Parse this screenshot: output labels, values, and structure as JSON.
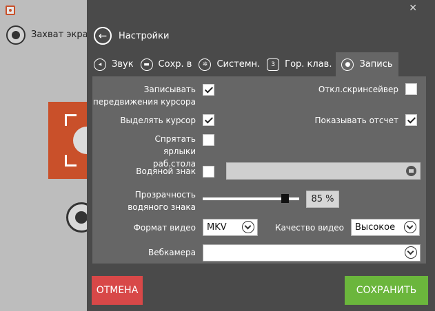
{
  "background_app": {
    "mode_label": "Захват экрана"
  },
  "dialog": {
    "close_glyph": "✕",
    "back_glyph": "←",
    "title": "Настройки"
  },
  "tabs": [
    {
      "label": "Звук",
      "icon": "speaker-icon"
    },
    {
      "label": "Сохр. в",
      "icon": "folder-icon"
    },
    {
      "label": "Системн.",
      "icon": "gears-icon"
    },
    {
      "label": "Гор. клав.",
      "icon": "hotkey-icon"
    },
    {
      "label": "Запись",
      "icon": "record-icon",
      "active": true
    }
  ],
  "settings": {
    "record_cursor": {
      "label": "Записывать передвижения курсора",
      "checked": true
    },
    "disable_screensaver": {
      "label": "Откл.скринсейвер",
      "checked": false
    },
    "highlight_cursor": {
      "label": "Выделять курсор",
      "checked": true
    },
    "show_report": {
      "label": "Показывать отсчет",
      "checked": true
    },
    "hide_desktop_icons": {
      "label": "Спрятать ярлыки раб.стола",
      "checked": false
    },
    "watermark": {
      "label": "Водяной знак",
      "checked": false,
      "path": ""
    },
    "watermark_opacity": {
      "label": "Прозрачность водяного знака",
      "value_text": "85 %",
      "value": 0.85
    },
    "video_format": {
      "label": "Формат видео",
      "value": "MKV"
    },
    "video_quality": {
      "label": "Качество видео",
      "value": "Высокое"
    },
    "webcam": {
      "label": "Вебкамера",
      "value": ""
    }
  },
  "buttons": {
    "cancel": "ОТМЕНА",
    "save": "СОХРАНИТЬ"
  },
  "colors": {
    "cancel": "#d84848",
    "save": "#6bb63c",
    "accent": "#c9502a"
  }
}
